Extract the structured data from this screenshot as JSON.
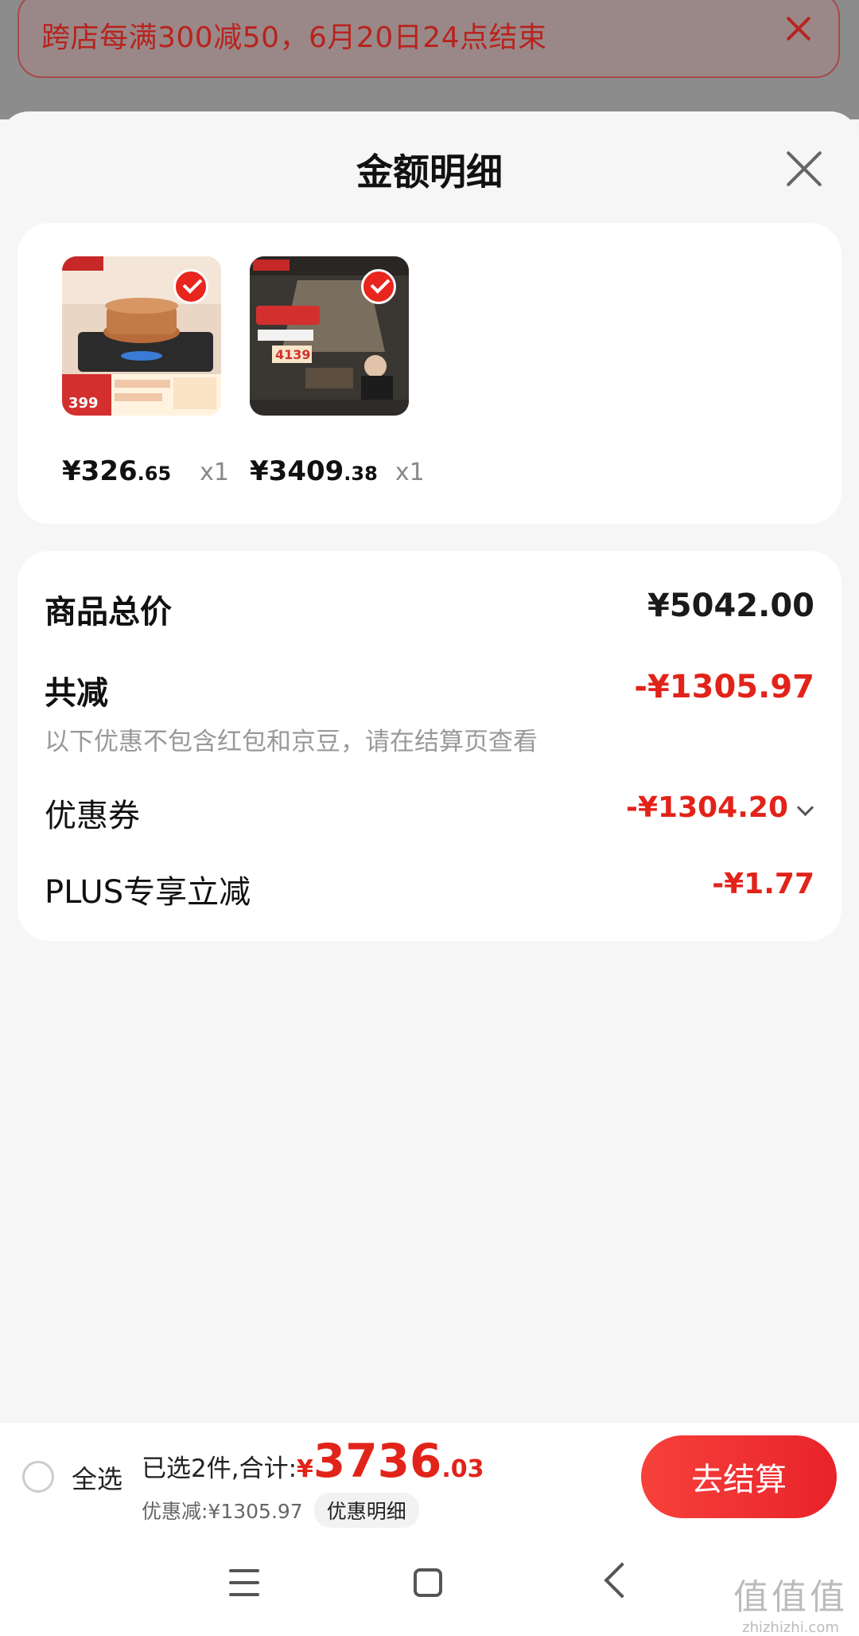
{
  "promo": {
    "text": "跨店每满300减50，6月20日24点结束"
  },
  "sheet": {
    "title": "金额明细"
  },
  "products": [
    {
      "price_int": "¥326",
      "price_dec": ".65",
      "qty": "x1",
      "image": "gas-stove-product-image"
    },
    {
      "price_int": "¥3409",
      "price_dec": ".38",
      "qty": "x1",
      "image": "range-hood-product-image"
    }
  ],
  "summary": {
    "total_label": "商品总价",
    "total_value": "¥5042.00",
    "reduce_label": "共减",
    "reduce_value": "-¥1305.97",
    "reduce_note": "以下优惠不包含红包和京豆，请在结算页查看",
    "coupon_label": "优惠券",
    "coupon_value": "-¥1304.20",
    "plus_label": "PLUS专享立减",
    "plus_value": "-¥1.77"
  },
  "bottom_bar": {
    "select_all": "全选",
    "total_prefix": "已选2件,合计:",
    "total_yen": "¥",
    "total_int": "3736",
    "total_dec": ".03",
    "discount_text": "优惠减:¥1305.97",
    "detail_button": "优惠明细",
    "checkout_button": "去结算"
  },
  "watermark": {
    "glyphs": "值值值",
    "url": "zhizhizhi.com"
  },
  "colors": {
    "accent_red": "#e2231a",
    "checkout_gradient": "#f7413b"
  }
}
